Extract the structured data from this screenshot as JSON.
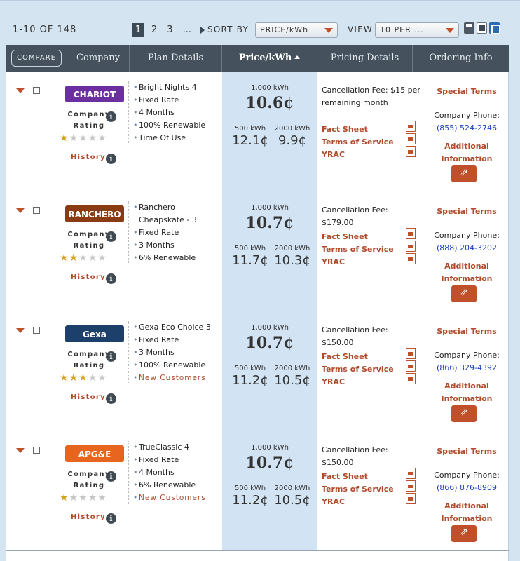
{
  "toolbar": {
    "count": "1-10 OF 148",
    "pages": [
      "1",
      "2",
      "3",
      "..."
    ],
    "sort_label": "SORT BY",
    "sort_value": "PRICE/kWh",
    "view_label": "VIEW",
    "view_value": "10 PER ..."
  },
  "header": {
    "compare": "COMPARE",
    "company": "Company",
    "plan_details": "Plan Details",
    "price": "Price/kWh",
    "pricing_details": "Pricing Details",
    "ordering_info": "Ordering Info"
  },
  "labels": {
    "company_rating_1": "Company",
    "company_rating_2": "Rating",
    "history": "History",
    "kwh_1000": "1,000 kWh",
    "kwh_500": "500 kWh",
    "kwh_2000": "2000 kWh",
    "fact_sheet": "Fact Sheet",
    "tos": "Terms of Service",
    "yrac": "YRAC",
    "special_terms": "Special Terms",
    "company_phone": "Company Phone:",
    "additional_1": "Additional",
    "additional_2": "Information"
  },
  "plans": [
    {
      "company": "CHARIOT",
      "logo_color": "#6b2fa0",
      "rating": 1,
      "lines": [
        "Bright Nights 4",
        "Fixed Rate",
        "4 Months",
        "100% Renewable",
        "Time Of Use"
      ],
      "p1000": "10.6¢",
      "p500": "12.1¢",
      "p2000": "9.9¢",
      "fee": "Cancellation Fee: $15 per remaining month",
      "phone": "(855) 524-2746"
    },
    {
      "company": "RANCHERO",
      "logo_color": "#8b3b12",
      "rating": 2,
      "lines": [
        "Ranchero Cheapskate - 3",
        "Fixed Rate",
        "3 Months",
        "6% Renewable"
      ],
      "p1000": "10.7¢",
      "p500": "11.7¢",
      "p2000": "10.3¢",
      "fee": "Cancellation Fee: $179.00",
      "phone": "(888) 204-3202"
    },
    {
      "company": "Gexa",
      "logo_color": "#1d3f6b",
      "rating": 3,
      "lines": [
        "Gexa Eco Choice 3",
        "Fixed Rate",
        "3 Months",
        "100% Renewable",
        "New Customers"
      ],
      "p1000": "10.7¢",
      "p500": "11.2¢",
      "p2000": "10.5¢",
      "fee": "Cancellation Fee: $150.00",
      "phone": "(866) 329-4392"
    },
    {
      "company": "APG&E",
      "logo_color": "#e8651f",
      "rating": 1,
      "lines": [
        "TrueClassic 4",
        "Fixed Rate",
        "4 Months",
        "6% Renewable",
        "New Customers"
      ],
      "p1000": "10.7¢",
      "p500": "11.2¢",
      "p2000": "10.5¢",
      "fee": "Cancellation Fee: $150.00",
      "phone": "(866) 876-8909"
    }
  ]
}
